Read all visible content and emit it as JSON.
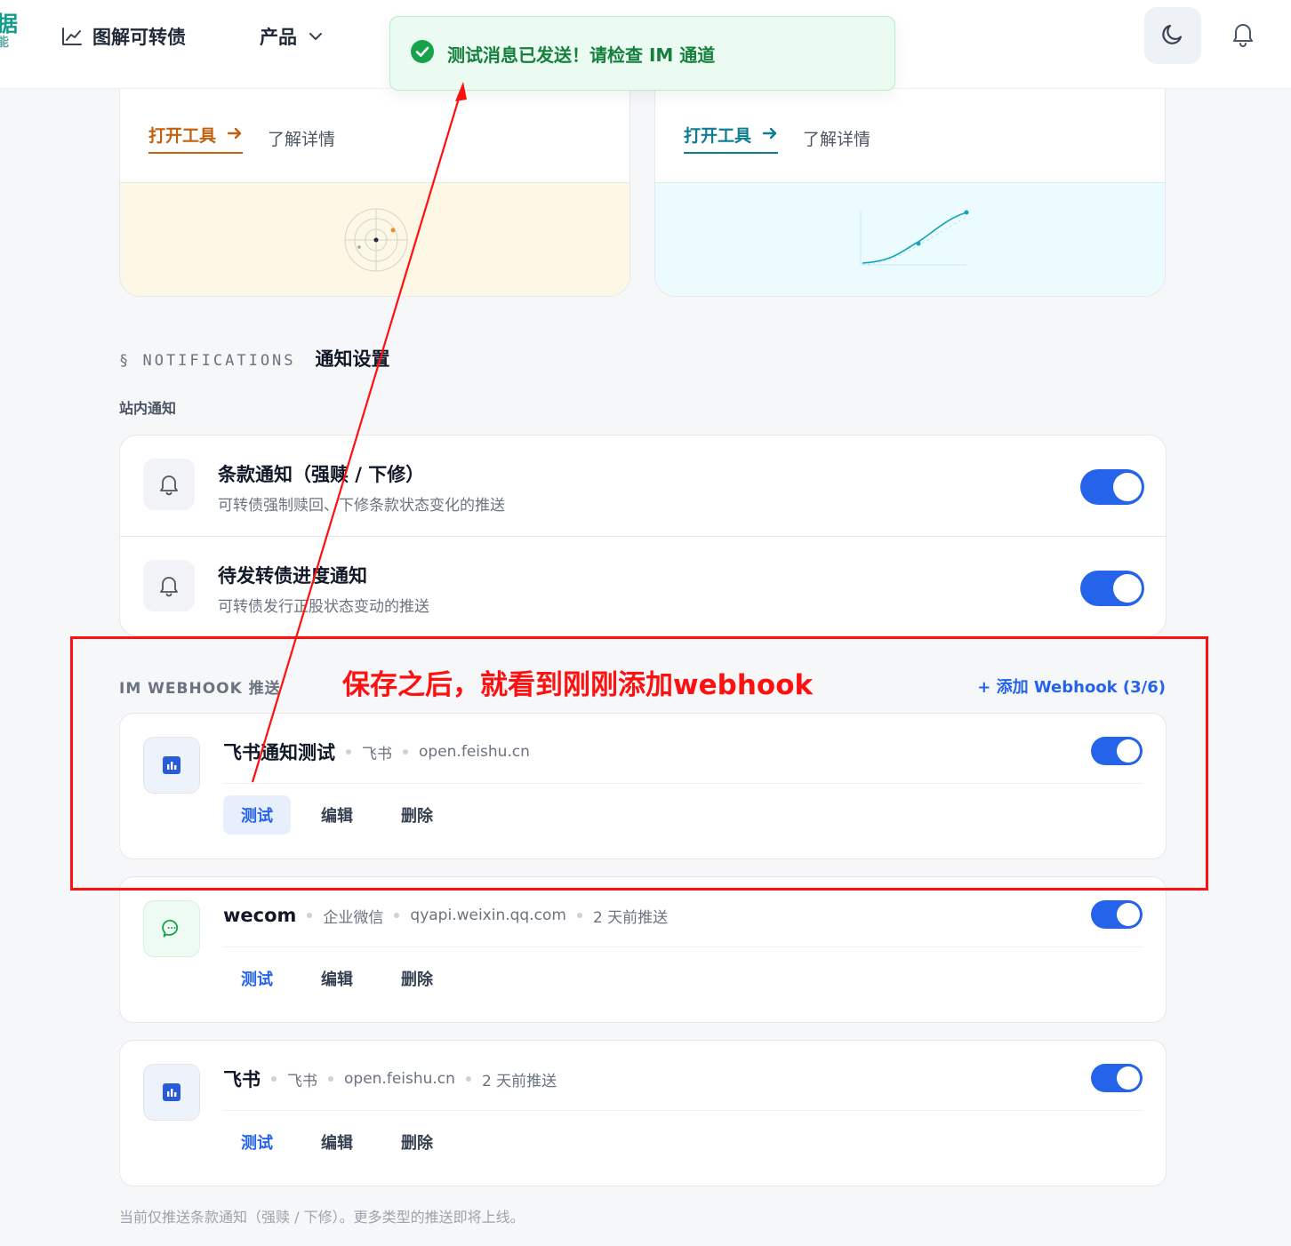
{
  "header": {
    "brand_line1": "据",
    "brand_line2": "能",
    "nav": [
      {
        "label": "图解可转债",
        "icon": "line-chart-icon"
      },
      {
        "label": "产品",
        "icon": "chevron-down-icon"
      }
    ],
    "moon_icon": "moon-icon",
    "bell_icon": "bell-icon"
  },
  "toast": {
    "message": "测试消息已发送！请检查 IM 通道",
    "icon": "check-circle-icon",
    "color": "#15803d"
  },
  "tool_cards": [
    {
      "open_label": "打开工具",
      "more_label": "了解详情",
      "accent": "#c2610f",
      "visual_icon": "radar-chart-icon"
    },
    {
      "open_label": "打开工具",
      "more_label": "了解详情",
      "accent": "#0e7d93",
      "visual_icon": "curve-chart-icon"
    }
  ],
  "notifications": {
    "section_label": "§ NOTIFICATIONS",
    "section_title": "通知设置",
    "sub_label": "站内通知",
    "items": [
      {
        "title": "条款通知（强赎 / 下修）",
        "desc": "可转债强制赎回、下修条款状态变化的推送",
        "enabled": true
      },
      {
        "title": "待发转债进度通知",
        "desc": "可转债发行正股状态变动的推送",
        "enabled": true
      }
    ]
  },
  "webhooks": {
    "label": "IM WEBHOOK 推送",
    "add_label": "+ 添加 Webhook (3/6)",
    "items": [
      {
        "name": "飞书通知测试",
        "platform": "飞书",
        "host": "open.feishu.cn",
        "last_push": "",
        "enabled": true,
        "icon": "feishu-icon"
      },
      {
        "name": "wecom",
        "platform": "企业微信",
        "host": "qyapi.weixin.qq.com",
        "last_push": "2 天前推送",
        "enabled": true,
        "icon": "wecom-icon"
      },
      {
        "name": "飞书",
        "platform": "飞书",
        "host": "open.feishu.cn",
        "last_push": "2 天前推送",
        "enabled": true,
        "icon": "feishu-icon"
      }
    ],
    "actions": {
      "test": "测试",
      "edit": "编辑",
      "delete": "删除"
    }
  },
  "footnote": "当前仅推送条款通知（强赎 / 下修）。更多类型的推送即将上线。",
  "annotation": {
    "text": "保存之后，就看到刚刚添加webhook",
    "color": "#ff1010"
  }
}
